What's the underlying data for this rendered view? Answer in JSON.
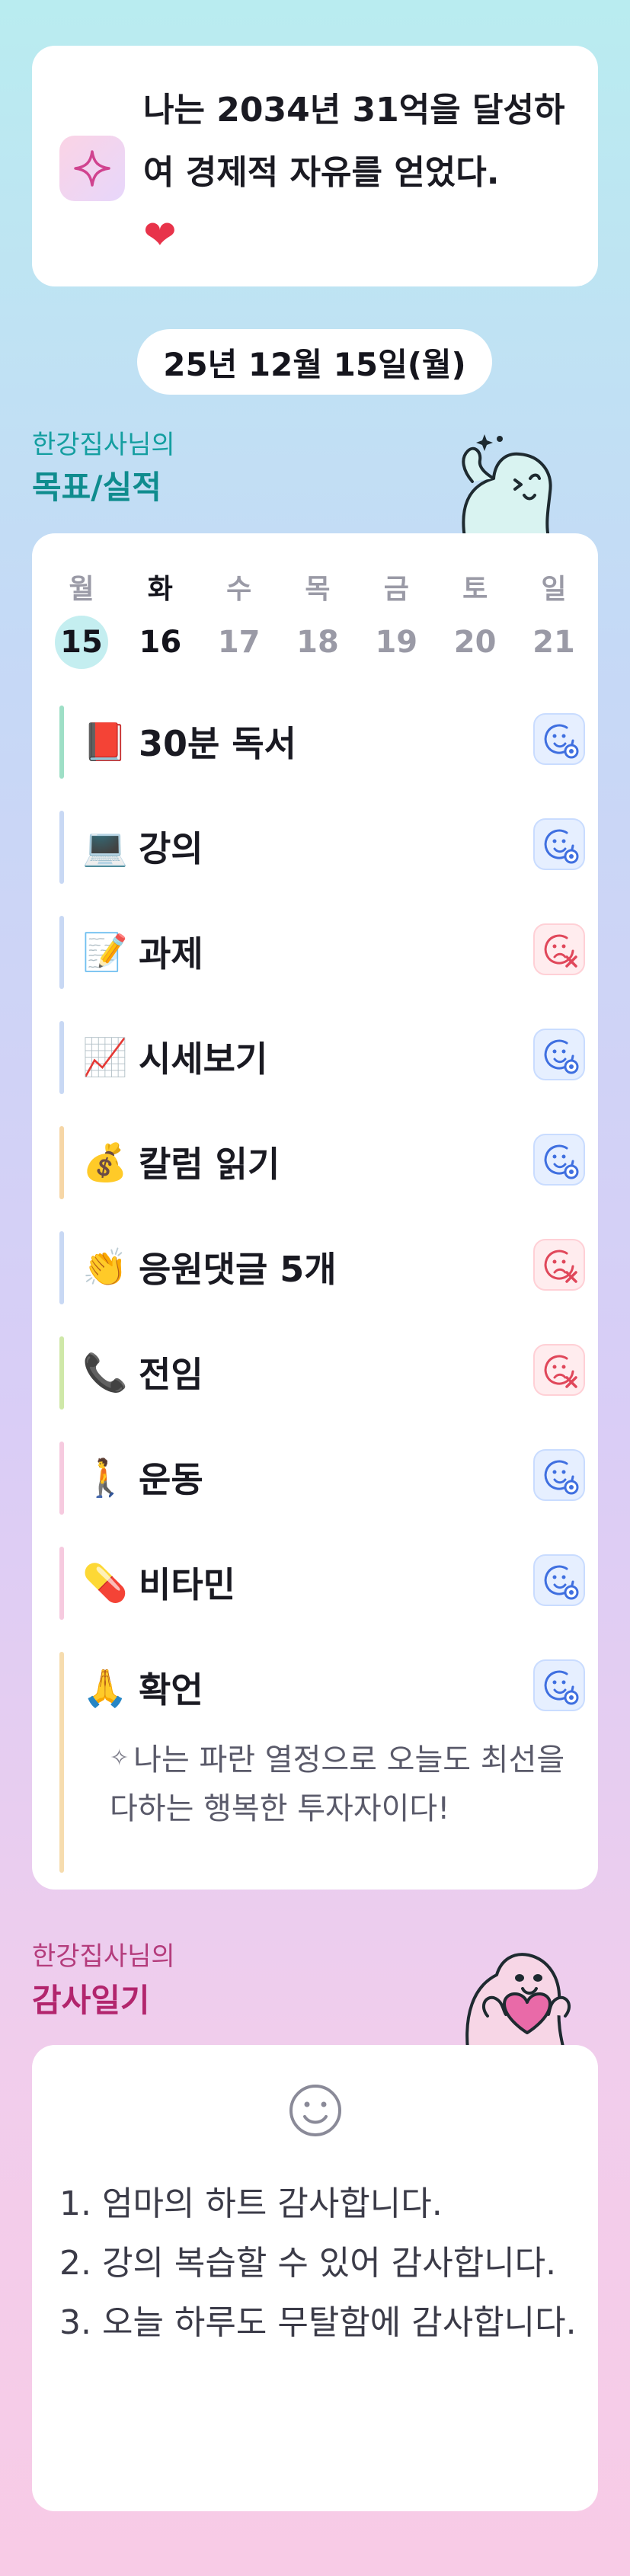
{
  "goal": {
    "icon": "sparkle-icon",
    "text": "나는 2034년 31억을 달성하여 경제적 자유를 얻었다.",
    "heart": "❤"
  },
  "date": "25년 12월 15일(월)",
  "goals_section": {
    "subtitle": "한강집사님의",
    "title": "목표/실적"
  },
  "week": [
    {
      "name": "월",
      "num": "15",
      "state": "today"
    },
    {
      "name": "화",
      "num": "16",
      "state": "selected"
    },
    {
      "name": "수",
      "num": "17",
      "state": ""
    },
    {
      "name": "목",
      "num": "18",
      "state": ""
    },
    {
      "name": "금",
      "num": "19",
      "state": ""
    },
    {
      "name": "토",
      "num": "20",
      "state": ""
    },
    {
      "name": "일",
      "num": "21",
      "state": ""
    }
  ],
  "tasks": [
    {
      "emoji": "📕",
      "label": "30분 독서",
      "status": "done",
      "color": "#9edfc6"
    },
    {
      "emoji": "💻",
      "label": "강의",
      "status": "done",
      "color": "#c8d8f4"
    },
    {
      "emoji": "📝",
      "label": "과제",
      "status": "fail",
      "color": "#c8d8f4"
    },
    {
      "emoji": "📈",
      "label": "시세보기",
      "status": "done",
      "color": "#c8d8f4"
    },
    {
      "emoji": "💰",
      "label": "칼럼 읽기",
      "status": "done",
      "color": "#f6d6a6"
    },
    {
      "emoji": "👏",
      "label": "응원댓글 5개",
      "status": "fail",
      "color": "#c8d8f4"
    },
    {
      "emoji": "📞",
      "label": "전임",
      "status": "fail",
      "color": "#cfe8a8"
    },
    {
      "emoji": "🚶",
      "label": "운동",
      "status": "done",
      "color": "#f6cadf"
    },
    {
      "emoji": "💊",
      "label": "비타민",
      "status": "done",
      "color": "#f6cadf"
    },
    {
      "emoji": "🙏",
      "label": "확언",
      "status": "done",
      "color": "#f6dcae"
    }
  ],
  "affirmation": "나는 파란 열정으로 오늘도 최선을 다하는 행복한 투자자이다!",
  "thanks_section": {
    "subtitle": "한강집사님의",
    "title": "감사일기"
  },
  "thanks": [
    "1. 엄마의 하트 감사합니다.",
    "2. 강의 복습할 수 있어 감사합니다.",
    "3. 오늘 하루도 무탈함에 감사합니다."
  ],
  "colors": {
    "accent_teal": "#149ea0",
    "accent_pink": "#b2256d",
    "done_blue": "#3f6fe0",
    "fail_red": "#e0475a"
  }
}
